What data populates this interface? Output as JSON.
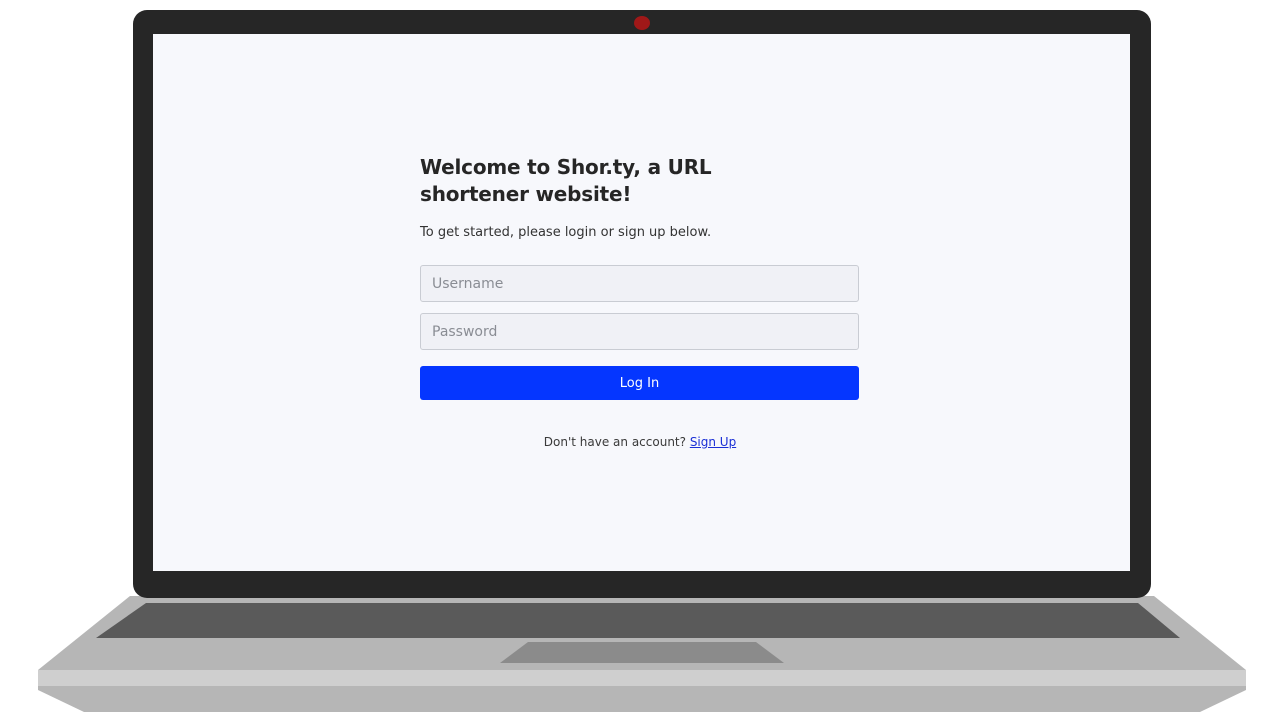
{
  "page": {
    "heading": "Welcome to Shor.ty, a URL shortener website!",
    "subheading": "To get started, please login or sign up below."
  },
  "form": {
    "username_placeholder": "Username",
    "username_value": "",
    "password_placeholder": "Password",
    "password_value": "",
    "login_label": "Log In"
  },
  "signup": {
    "prompt": "Don't have an account?",
    "link_label": "Sign Up"
  },
  "colors": {
    "screen_background": "#f7f8fc",
    "button_primary": "#0536ff",
    "link": "#1a2fd6",
    "bezel": "#262626",
    "webcam_indicator": "#a01818"
  },
  "icons": {
    "webcam": "webcam-light-icon"
  }
}
